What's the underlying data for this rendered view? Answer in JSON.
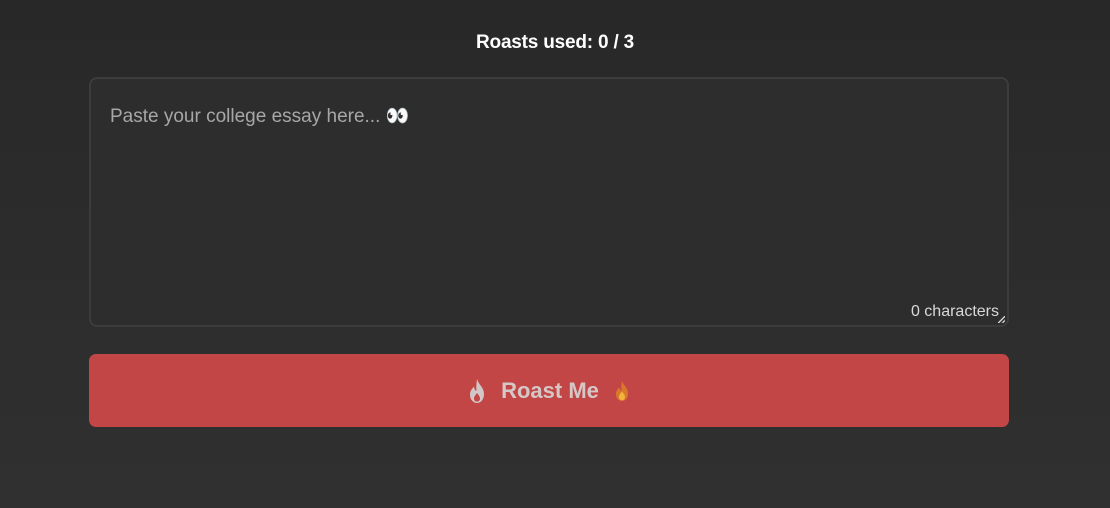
{
  "usage": {
    "text": "Roasts used: 0 / 3"
  },
  "essay": {
    "placeholder": "Paste your college essay here... 👀",
    "value": "",
    "char_count_text": "0 characters"
  },
  "roast_button": {
    "label": "Roast Me",
    "leading_icon": "flame-outline-icon",
    "trailing_icon": "fire-emoji-icon",
    "background_color": "#c24646"
  }
}
